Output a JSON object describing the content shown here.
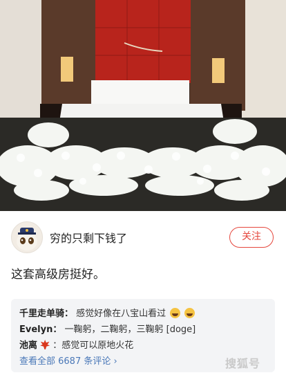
{
  "post": {
    "username": "穷的只剩下钱了",
    "follow_label": "关注",
    "text": "这套高级房挺好。"
  },
  "comments": {
    "items": [
      {
        "author": "千里走单骑：",
        "text": "感觉好像在八宝山看过"
      },
      {
        "author": "Evelyn：",
        "text": "一鞠躬，二鞠躬，三鞠躬 [doge]"
      },
      {
        "author": "池离",
        "text": "：感觉可以原地火花"
      }
    ],
    "view_all": "查看全部 6687 条评论"
  },
  "watermark": "搜狐号",
  "colors": {
    "accent": "#e5463c",
    "link": "#4a78b8"
  }
}
